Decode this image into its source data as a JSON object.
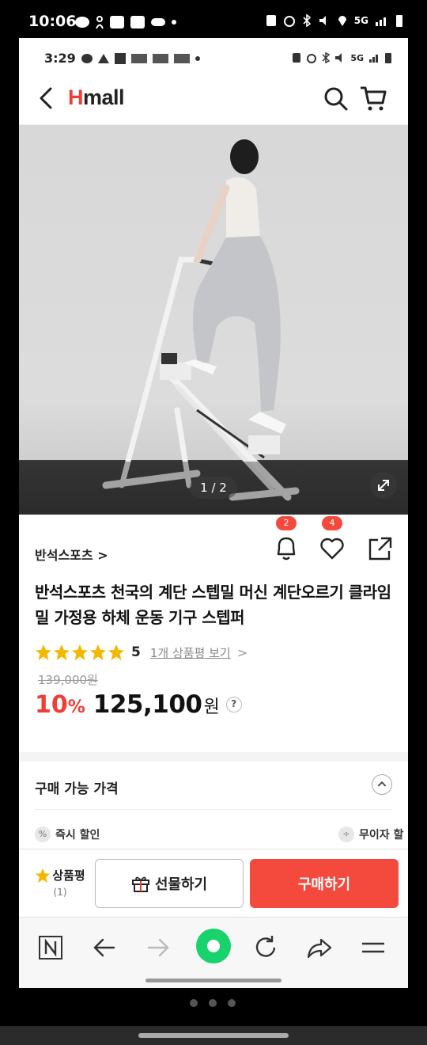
{
  "outer_status": {
    "time": "10:06",
    "network": "5G"
  },
  "inner_status": {
    "time": "3:29",
    "network": "5G"
  },
  "header": {
    "logo_h": "H",
    "logo_rest": "mall"
  },
  "hero": {
    "counter": "1 / 2"
  },
  "product": {
    "brand": "반석스포츠",
    "brand_chevron": ">",
    "alert_count": "2",
    "wish_count": "4",
    "title": "반석스포츠 천국의 계단 스텝밀 머신 계단오르기 클라임밀 가정용 하체 운동 기구 스텝퍼",
    "rating": "5",
    "review_link": "1개 상품평 보기",
    "review_chevron": ">",
    "original_price": "139,000원",
    "discount": "10",
    "discount_unit": "%",
    "price": "125,100",
    "currency": "원",
    "help": "?"
  },
  "buy_section": {
    "title": "구매 가능 가격",
    "benefit_left": "즉시 할인",
    "benefit_left_icon": "%",
    "benefit_right": "무이자 할",
    "benefit_right_icon": "÷"
  },
  "bottom_bar": {
    "review_label": "상품평",
    "review_count": "(1)",
    "gift_label": "선물하기",
    "buy_label": "구매하기"
  },
  "colors": {
    "accent": "#ef3e36",
    "buy_button": "#f44a3e",
    "star": "#f5b800",
    "browser_home": "#18d26b"
  }
}
